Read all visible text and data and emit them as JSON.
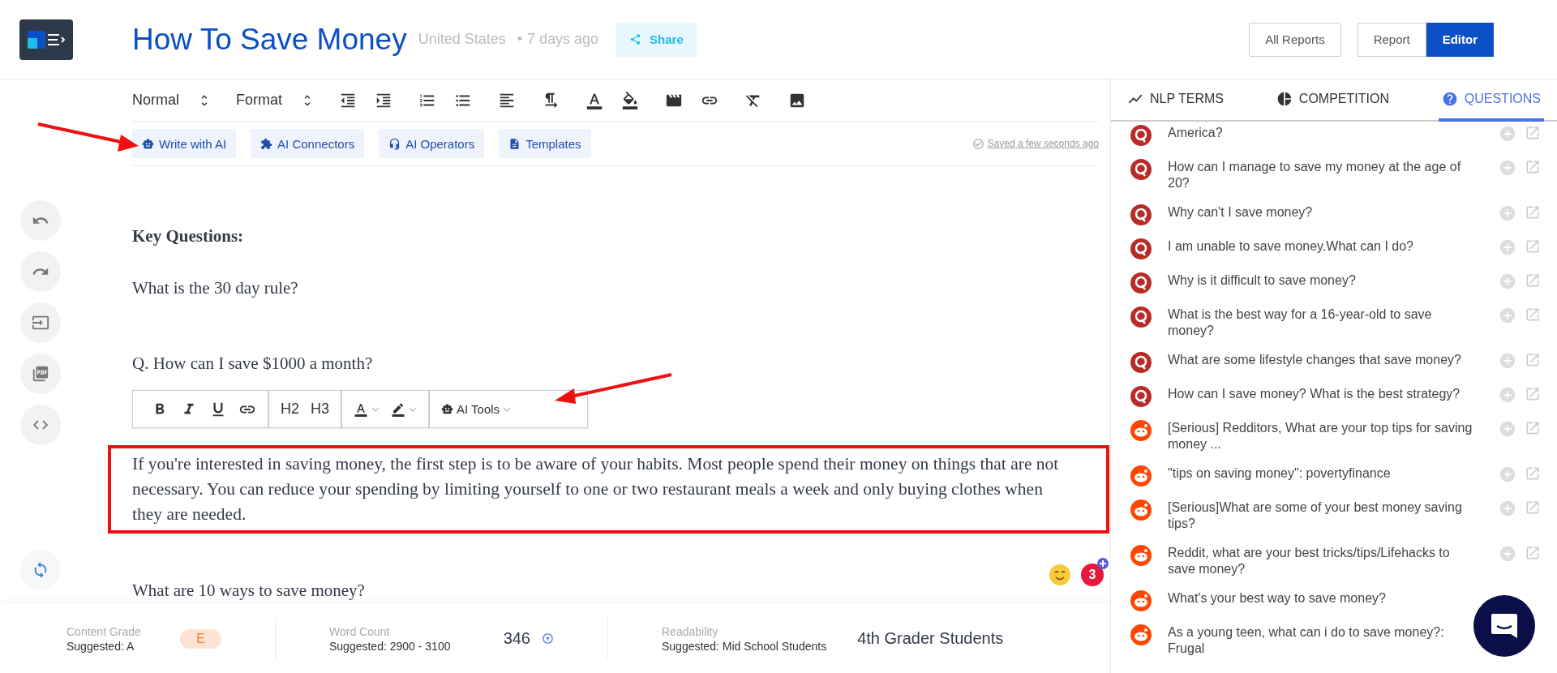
{
  "header": {
    "title": "How To Save Money",
    "location": "United States",
    "separator": "•",
    "age": "7 days ago",
    "share": "Share",
    "all_reports": "All Reports",
    "view_toggle": [
      {
        "label": "Report",
        "selected": false
      },
      {
        "label": "Editor",
        "selected": true
      }
    ]
  },
  "toolbar": {
    "block_style": "Normal",
    "format": "Format",
    "ai_buttons": [
      {
        "kind": "write",
        "label": "Write with AI"
      },
      {
        "kind": "connectors",
        "label": "AI Connectors"
      },
      {
        "kind": "operators",
        "label": "AI Operators"
      },
      {
        "kind": "templates",
        "label": "Templates"
      }
    ],
    "saved": "Saved a few seconds ago"
  },
  "document": {
    "blocks": [
      {
        "kind": "heading",
        "text": "Key Questions:"
      },
      {
        "kind": "paragraph",
        "text": "What is the 30 day rule?"
      },
      {
        "kind": "question",
        "text": "Q. How can I save $1000 a month?"
      },
      {
        "kind": "highlighted",
        "text": "If you're interested in saving money, the first step is to be aware of your habits. Most people spend their money on things that are not necessary. You can reduce your spending by limiting yourself to one or two restaurant meals a week and only buying clothes when they are needed."
      },
      {
        "kind": "question",
        "text": "What are 10 ways to save money?"
      }
    ]
  },
  "bubble_menu": {
    "headings": [
      "H2",
      "H3"
    ],
    "ai_tools": "AI Tools"
  },
  "notifications": {
    "count": "3"
  },
  "footer": {
    "metrics": [
      {
        "kind": "grade",
        "label": "Content Grade",
        "suggested": "Suggested: A",
        "value": "E"
      },
      {
        "kind": "count",
        "label": "Word Count",
        "suggested": "Suggested: 2900 - 3100",
        "value": "346"
      },
      {
        "kind": "text",
        "label": "Readability",
        "suggested": "Suggested: Mid School Students",
        "value": "4th Grader Students"
      }
    ]
  },
  "panel": {
    "tabs": [
      {
        "kind": "nlp",
        "label": "NLP TERMS",
        "selected": false
      },
      {
        "kind": "competition",
        "label": "COMPETITION",
        "selected": false
      },
      {
        "kind": "questions",
        "label": "QUESTIONS",
        "selected": true
      }
    ],
    "questions": [
      {
        "kind": "quora",
        "text": "America?"
      },
      {
        "kind": "quora",
        "text": "How can I manage to save my money at the age of 20?"
      },
      {
        "kind": "quora",
        "text": "Why can't I save money?"
      },
      {
        "kind": "quora",
        "text": "I am unable to save money.What can I do?"
      },
      {
        "kind": "quora",
        "text": "Why is it difficult to save money?"
      },
      {
        "kind": "quora",
        "text": "What is the best way for a 16-year-old to save money?"
      },
      {
        "kind": "quora",
        "text": "What are some lifestyle changes that save money?"
      },
      {
        "kind": "quora",
        "text": "How can I save money? What is the best strategy?"
      },
      {
        "kind": "reddit",
        "text": "[Serious] Redditors, What are your top tips for saving money ..."
      },
      {
        "kind": "reddit",
        "text": "\"tips on saving money\": povertyfinance"
      },
      {
        "kind": "reddit",
        "text": "[Serious]What are some of your best money saving tips?"
      },
      {
        "kind": "reddit",
        "text": "Reddit, what are your best tricks/tips/Lifehacks to save money?"
      },
      {
        "kind": "reddit",
        "text": "What's your best way to save money?"
      },
      {
        "kind": "reddit",
        "text": "As a young teen, what can i do to save money?: Frugal"
      }
    ]
  }
}
